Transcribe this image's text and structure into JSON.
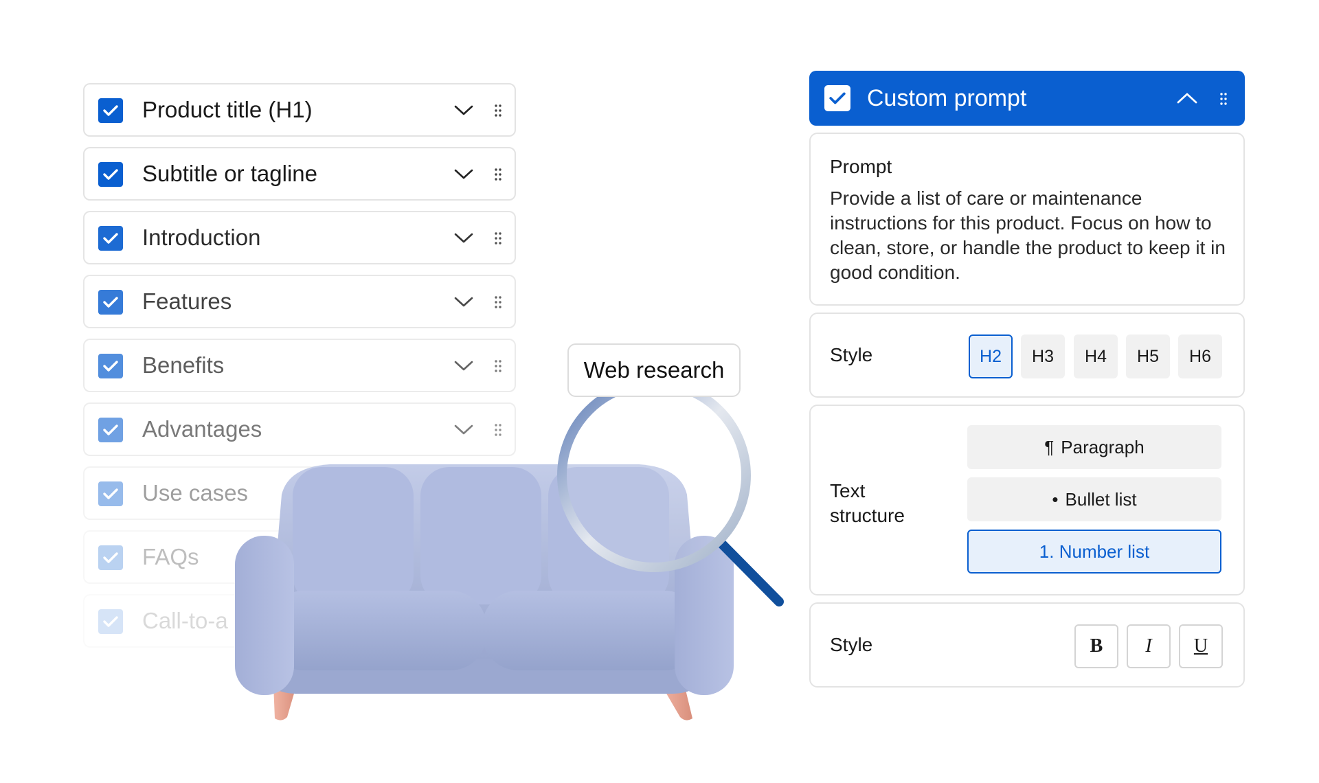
{
  "sections": [
    {
      "label": "Product title (H1)",
      "checked": true
    },
    {
      "label": "Subtitle or tagline",
      "checked": true
    },
    {
      "label": "Introduction",
      "checked": true
    },
    {
      "label": "Features",
      "checked": true
    },
    {
      "label": "Benefits",
      "checked": true
    },
    {
      "label": "Advantages",
      "checked": true
    },
    {
      "label": "Use cases",
      "checked": true
    },
    {
      "label": "FAQs",
      "checked": true
    },
    {
      "label": "Call-to-a",
      "checked": true
    }
  ],
  "web_research": {
    "label": "Web research"
  },
  "custom_prompt": {
    "title": "Custom prompt",
    "checked": true,
    "prompt_label": "Prompt",
    "prompt_text": "Provide a list of care or maintenance instructions for this product. Focus on how to clean, store, or handle the product to keep it in good condition.",
    "heading_style": {
      "label": "Style",
      "options": [
        "H2",
        "H3",
        "H4",
        "H5",
        "H6"
      ],
      "selected": "H2"
    },
    "text_structure": {
      "label": "Text structure",
      "options": [
        {
          "icon": "¶",
          "label": "Paragraph"
        },
        {
          "icon": "•",
          "label": "Bullet list"
        },
        {
          "icon": "",
          "label": "1. Number list"
        }
      ],
      "selected": "1. Number list"
    },
    "format_style": {
      "label": "Style",
      "options": [
        {
          "label": "B",
          "icon": "bold-icon"
        },
        {
          "label": "I",
          "icon": "italic-icon"
        },
        {
          "label": "U",
          "icon": "underline-icon"
        }
      ]
    }
  },
  "colors": {
    "accent": "#0a5fd0",
    "selected_bg": "#e7f0fb",
    "button_bg": "#f1f1f1",
    "border": "#e3e3e3",
    "sofa": "#aab6d9",
    "sofa_legs": "#e8a594"
  }
}
